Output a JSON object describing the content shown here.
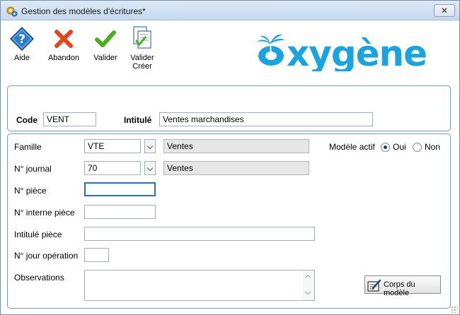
{
  "window": {
    "title": "Gestion des modèles d'écritures*",
    "close_label": "✕"
  },
  "toolbar": {
    "aide": "Aide",
    "abandon": "Abandon",
    "valider": "Valider",
    "valider_creer_1": "Valider",
    "valider_creer_2": "Créer"
  },
  "brand": {
    "logo_text": "oxygène",
    "color": "#1aa3dc"
  },
  "header": {
    "code_label": "Code",
    "code_value": "VENT",
    "intitule_label": "Intitulé",
    "intitule_value": "Ventes marchandises"
  },
  "form": {
    "famille_label": "Famille",
    "famille_code": "VTE",
    "famille_name": "Ventes",
    "modele_actif_label": "Modèle actif",
    "oui_label": "Oui",
    "non_label": "Non",
    "modele_actif_selected": "Oui",
    "journal_label": "N° journal",
    "journal_code": "70",
    "journal_name": "Ventes",
    "piece_label": "N° pièce",
    "piece_value": "",
    "interne_label": "N° interne pièce",
    "interne_value": "",
    "intitule_piece_label": "Intitulé pièce",
    "intitule_piece_value": "",
    "jour_label": "N° jour opération",
    "jour_value": "",
    "observations_label": "Observations",
    "observations_value": "",
    "corps_button": "Corps du modèle"
  },
  "colors": {
    "accent": "#2f6fae",
    "panel_border": "#7a99bf",
    "abandon_red": "#e2471c",
    "valider_green": "#4caf1f"
  }
}
